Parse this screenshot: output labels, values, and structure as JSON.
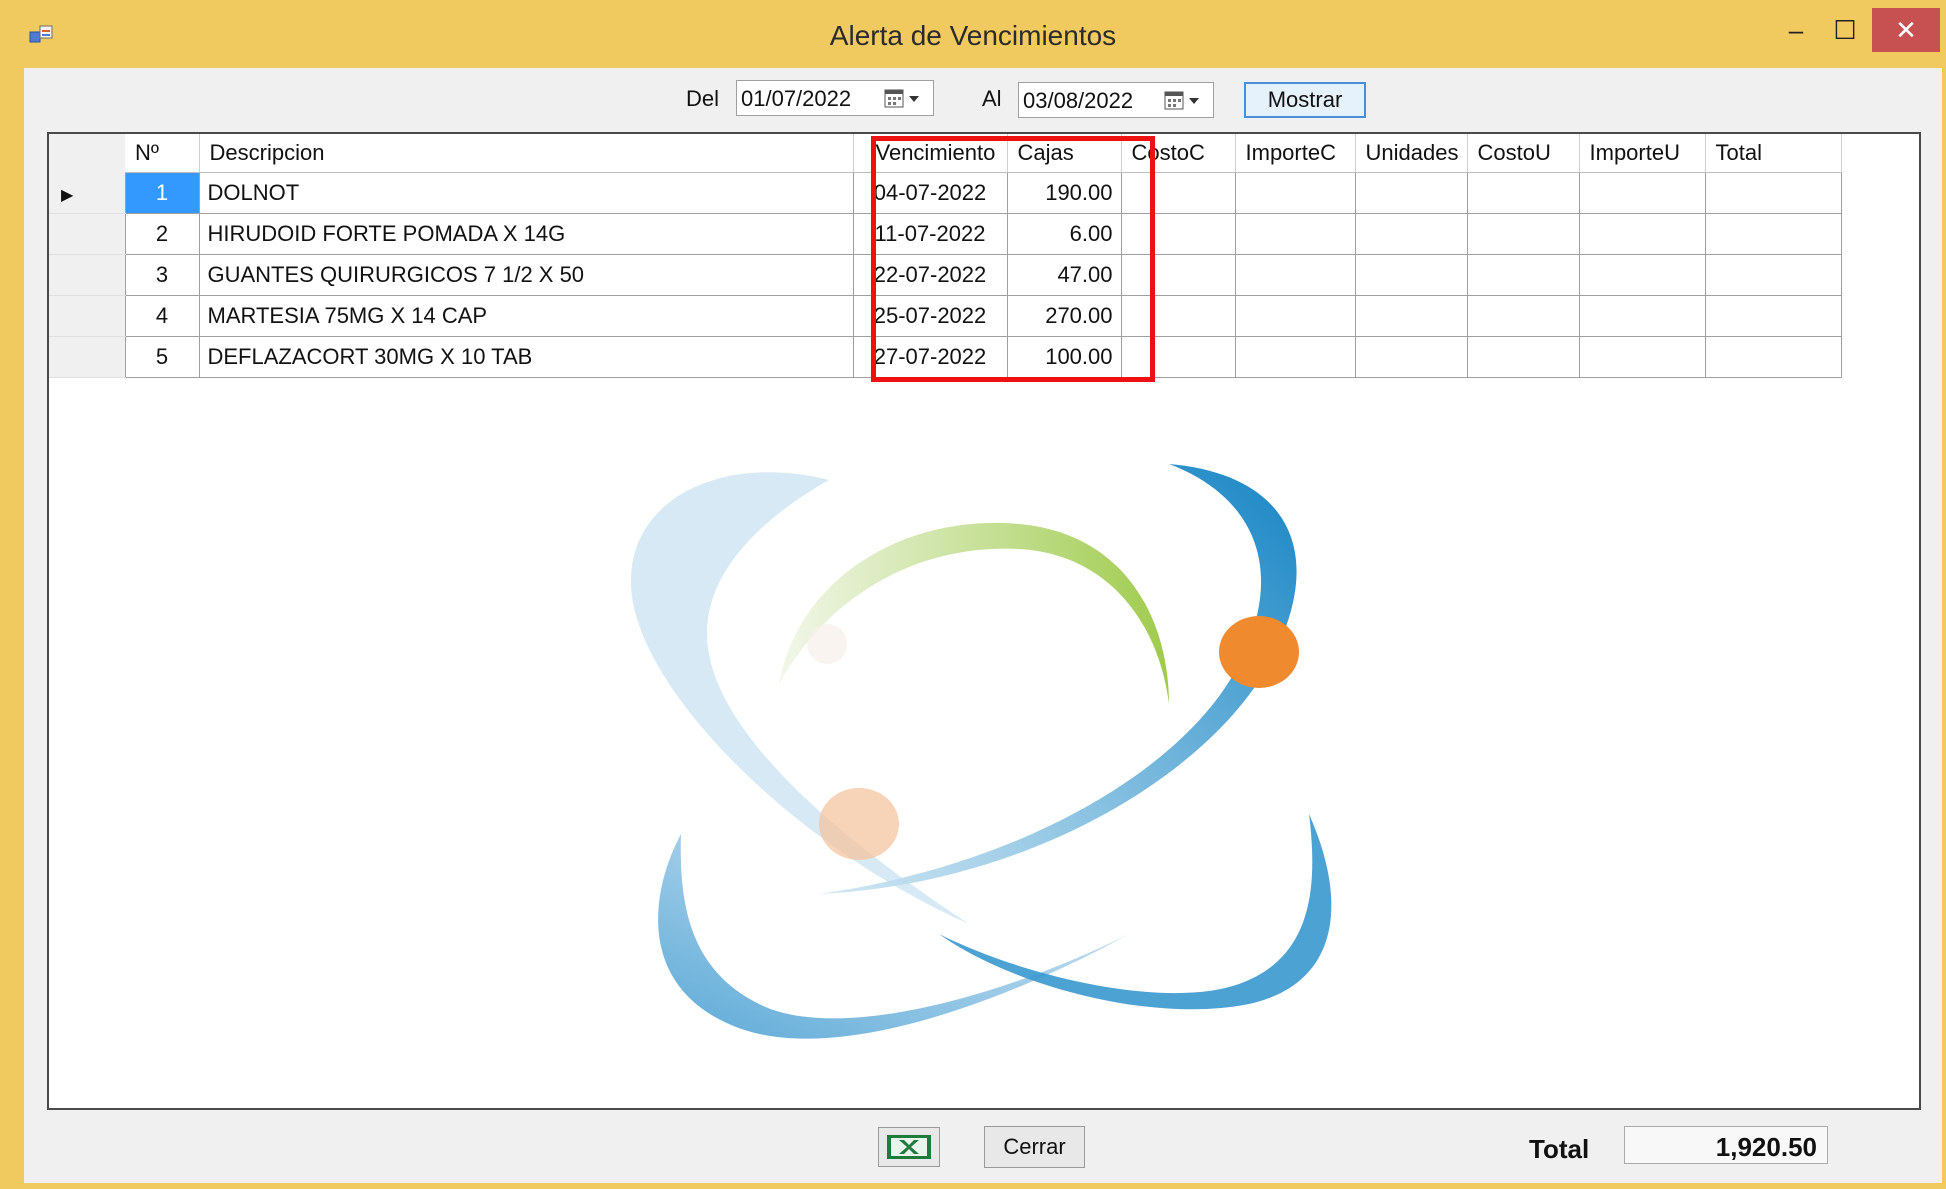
{
  "window": {
    "title": "Alerta de Vencimientos",
    "minimize_glyph": "‒",
    "maximize_glyph": "☐",
    "close_glyph": "✕",
    "titlebar_color": "#f0c95f"
  },
  "filters": {
    "from_label": "Del",
    "from_value": "01/07/2022",
    "to_label": "Al",
    "to_value": "03/08/2022",
    "show_button": "Mostrar"
  },
  "grid": {
    "columns": [
      "Nº",
      "Descripcion",
      "Vencimiento",
      "Cajas",
      "CostoC",
      "ImporteC",
      "Unidades",
      "CostoU",
      "ImporteU",
      "Total"
    ],
    "rows": [
      {
        "no": "1",
        "descripcion": "DOLNOT",
        "vencimiento": "04-07-2022",
        "cajas": "190.00"
      },
      {
        "no": "2",
        "descripcion": "HIRUDOID FORTE POMADA X 14G",
        "vencimiento": "11-07-2022",
        "cajas": "6.00"
      },
      {
        "no": "3",
        "descripcion": "GUANTES QUIRURGICOS 7 1/2 X 50",
        "vencimiento": "22-07-2022",
        "cajas": "47.00"
      },
      {
        "no": "4",
        "descripcion": "MARTESIA 75MG  X 14 CAP",
        "vencimiento": "25-07-2022",
        "cajas": "270.00"
      },
      {
        "no": "5",
        "descripcion": "DEFLAZACORT 30MG X 10 TAB",
        "vencimiento": "27-07-2022",
        "cajas": "100.00"
      }
    ],
    "current_row_glyph": "▶",
    "highlight_color": "#ee1111",
    "selection_color": "#3399ff"
  },
  "footer": {
    "excel_icon": "excel-icon",
    "close_button": "Cerrar",
    "total_label": "Total",
    "total_value": "1,920.50"
  }
}
